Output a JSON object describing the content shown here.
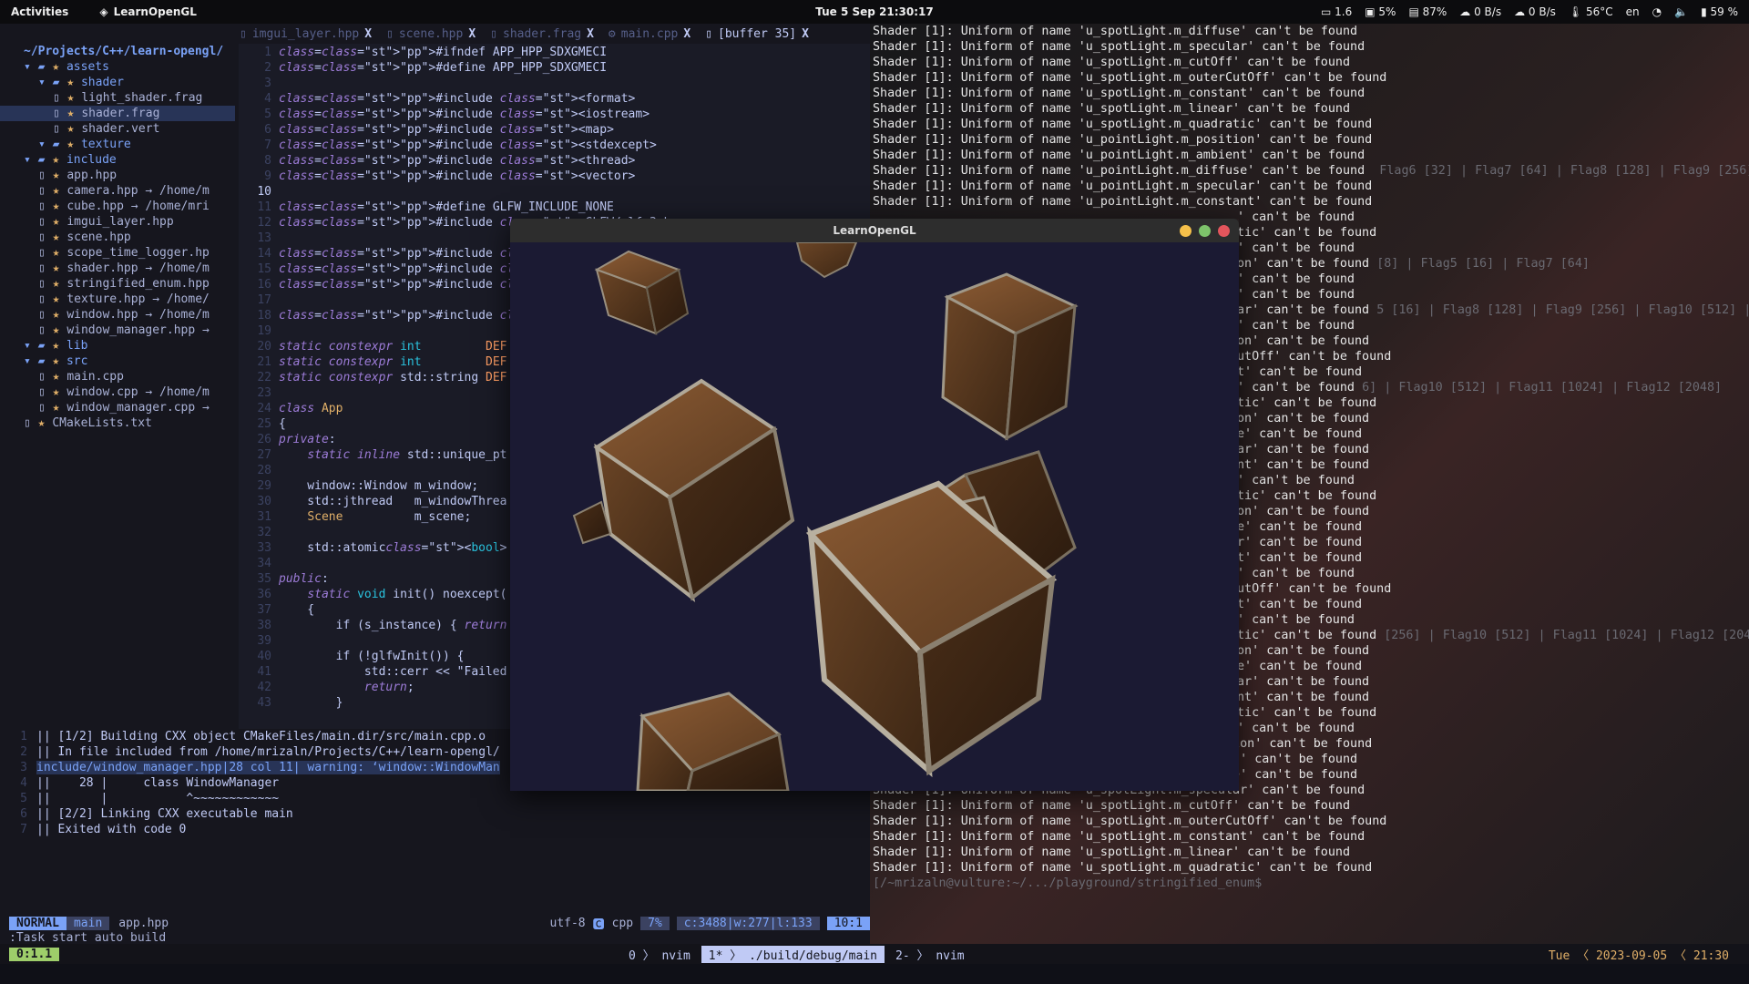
{
  "topbar": {
    "activities": "Activities",
    "app_name": "LearnOpenGL",
    "clock": "Tue 5 Sep  21:30:17",
    "tray": {
      "load": "1.6",
      "cpu": "5%",
      "mem": "87%",
      "down": "0 B/s",
      "up": "0 B/s",
      "temp": "56°C",
      "lang": "en",
      "battery": "59 %"
    }
  },
  "tabs": [
    {
      "label": "imgui_layer.hpp",
      "close": "X"
    },
    {
      "label": "scene.hpp",
      "close": "X"
    },
    {
      "label": "shader.frag",
      "close": "X"
    },
    {
      "label": "main.cpp",
      "close": "X"
    },
    {
      "label": "[buffer 35]",
      "close": "X"
    }
  ],
  "tree": {
    "root": "~/Projects/C++/learn-opengl/",
    "items": [
      {
        "name": "assets",
        "kind": "dir",
        "indent": 1
      },
      {
        "name": "shader",
        "kind": "dir",
        "indent": 2
      },
      {
        "name": "light_shader.frag",
        "kind": "file",
        "indent": 3
      },
      {
        "name": "shader.frag",
        "kind": "file",
        "indent": 3,
        "selected": true
      },
      {
        "name": "shader.vert",
        "kind": "file",
        "indent": 3
      },
      {
        "name": "texture",
        "kind": "dir",
        "indent": 2
      },
      {
        "name": "include",
        "kind": "dir",
        "indent": 1
      },
      {
        "name": "app.hpp",
        "kind": "file",
        "indent": 2
      },
      {
        "name": "camera.hpp → /home/m",
        "kind": "file",
        "indent": 2
      },
      {
        "name": "cube.hpp → /home/mri",
        "kind": "file",
        "indent": 2
      },
      {
        "name": "imgui_layer.hpp",
        "kind": "file",
        "indent": 2
      },
      {
        "name": "scene.hpp",
        "kind": "file",
        "indent": 2
      },
      {
        "name": "scope_time_logger.hp",
        "kind": "file",
        "indent": 2
      },
      {
        "name": "shader.hpp → /home/m",
        "kind": "file",
        "indent": 2
      },
      {
        "name": "stringified_enum.hpp",
        "kind": "file",
        "indent": 2
      },
      {
        "name": "texture.hpp → /home/",
        "kind": "file",
        "indent": 2
      },
      {
        "name": "window.hpp → /home/m",
        "kind": "file",
        "indent": 2
      },
      {
        "name": "window_manager.hpp →",
        "kind": "file",
        "indent": 2
      },
      {
        "name": "lib",
        "kind": "dir",
        "indent": 1
      },
      {
        "name": "src",
        "kind": "dir",
        "indent": 1
      },
      {
        "name": "main.cpp",
        "kind": "file",
        "indent": 2
      },
      {
        "name": "window.cpp → /home/m",
        "kind": "file",
        "indent": 2
      },
      {
        "name": "window_manager.cpp →",
        "kind": "file",
        "indent": 2
      },
      {
        "name": "CMakeLists.txt",
        "kind": "file",
        "indent": 1
      }
    ]
  },
  "code_lines": [
    "#ifndef APP_HPP_SDXGMECI",
    "#define APP_HPP_SDXGMECI",
    "",
    "#include <format>",
    "#include <iostream>",
    "#include <map>",
    "#include <stdexcept>",
    "#include <thread>",
    "#include <vector>",
    "",
    "#define GLFW_INCLUDE_NONE",
    "#include <GLFW/glfw3.h>",
    "",
    "#include \"window.hpp\"",
    "#include \"window_manager.hpp\"",
    "#include \"scope_time_logger.hpp\"",
    "",
    "#include \"scene.hpp\"",
    "",
    "static constexpr int         DEF",
    "static constexpr int         DEF",
    "static constexpr std::string DEF",
    "",
    "class App",
    "{",
    "private:",
    "    static inline std::unique_pt",
    "",
    "    window::Window m_window;",
    "    std::jthread   m_windowThrea",
    "    Scene          m_scene;",
    "",
    "    std::atomic<bool> m_running{",
    "",
    "public:",
    "    static void init() noexcept(",
    "    {",
    "        if (s_instance) { return",
    "",
    "        if (!glfwInit()) {",
    "            std::cerr << \"Failed",
    "            return;",
    "        }"
  ],
  "quickfix": [
    "|| [1/2] Building CXX object CMakeFiles/main.dir/src/main.cpp.o",
    "|| In file included from /home/mrizaln/Projects/C++/learn-opengl/",
    "include/window_manager.hpp|28 col 11| warning: ‘window::WindowMan",
    "||    28 |     class WindowManager",
    "||       |           ^~~~~~~~~~~~~",
    "|| [2/2] Linking CXX executable main",
    "|| Exited with code 0"
  ],
  "statusline": {
    "mode": "NORMAL",
    "branch": " main",
    "file": "app.hpp",
    "encoding": "utf-8",
    "filetype": "cpp",
    "percent": "7%",
    "counts": "c:3488|w:277|l:133",
    "position": "10:1"
  },
  "cmdline": ":Task start auto build",
  "terminal_lines": [
    "Shader [1]: Uniform of name 'u_spotLight.m_diffuse' can't be found",
    "Shader [1]: Uniform of name 'u_spotLight.m_specular' can't be found",
    "Shader [1]: Uniform of name 'u_spotLight.m_cutOff' can't be found",
    "Shader [1]: Uniform of name 'u_spotLight.m_outerCutOff' can't be found",
    "Shader [1]: Uniform of name 'u_spotLight.m_constant' can't be found",
    "Shader [1]: Uniform of name 'u_spotLight.m_linear' can't be found",
    "Shader [1]: Uniform of name 'u_spotLight.m_quadratic' can't be found",
    "Shader [1]: Uniform of name 'u_pointLight.m_position' can't be found",
    "Shader [1]: Uniform of name 'u_pointLight.m_ambient' can't be found",
    "Shader [1]: Uniform of name 'u_pointLight.m_diffuse' can't be found",
    "Shader [1]: Uniform of name 'u_pointLight.m_specular' can't be found",
    "Shader [1]: Uniform of name 'u_pointLight.m_constant' can't be found"
  ],
  "terminal_ghost": [
    {
      "row": 9,
      "text": "Flag6 [32] | Flag7 [64] | Flag8 [128] | Flag9 [256]"
    },
    {
      "row": 15,
      "text": "[8] | Flag5 [16] | Flag7 [64]"
    },
    {
      "row": 18,
      "text": "5 [16] | Flag8 [128] | Flag9 [256] | Flag10 [512] |"
    },
    {
      "row": 23,
      "text": "6] | Flag10 [512] | Flag11 [1024] | Flag12 [2048]"
    },
    {
      "row": 39,
      "text": "[256] | Flag10 [512] | Flag11 [1024] | Flag12 [2048]"
    }
  ],
  "terminal_right_col": [
    "' can't be found",
    "tic' can't be found",
    "' can't be found",
    "on' can't be found",
    "' can't be found",
    "' can't be found",
    "ar' can't be found",
    "' can't be found",
    "on' can't be found",
    "utOff' can't be found",
    "t' can't be found",
    "' can't be found",
    "tic' can't be found",
    "on' can't be found",
    "e' can't be found",
    "ar' can't be found",
    "nt' can't be found",
    "' can't be found",
    "tic' can't be found",
    "on' can't be found",
    "e' can't be found",
    "r' can't be found",
    "t' can't be found",
    "' can't be found",
    "utOff' can't be found",
    "t' can't be found",
    "' can't be found",
    "tic' can't be found",
    "on' can't be found",
    "e' can't be found",
    "ar' can't be found",
    "nt' can't be found",
    "tic' can't be found",
    "' can't be found"
  ],
  "terminal_bottom": [
    "Shader [1]: Uniform of name 'u_spotLight.m_direction' can't be found",
    "Shader [1]: Uniform of name 'u_spotLight.m_ambient' can't be found",
    "Shader [1]: Uniform of name 'u_spotLight.m_diffuse' can't be found",
    "Shader [1]: Uniform of name 'u_spotLight.m_specular' can't be found",
    "Shader [1]: Uniform of name 'u_spotLight.m_cutOff' can't be found",
    "Shader [1]: Uniform of name 'u_spotLight.m_outerCutOff' can't be found",
    "Shader [1]: Uniform of name 'u_spotLight.m_constant' can't be found",
    "Shader [1]: Uniform of name 'u_spotLight.m_linear' can't be found",
    "Shader [1]: Uniform of name 'u_spotLight.m_quadratic' can't be found"
  ],
  "terminal_prompt": "[/~mrizaln@vulture:~/.../playground/stringified_enum$",
  "glwindow": {
    "title": "LearnOpenGL"
  },
  "tmux": {
    "session": "0:1.1",
    "windows": [
      {
        "index": "0",
        "name": "nvim",
        "active": false
      },
      {
        "index": "1*",
        "name": "./build/debug/main",
        "active": true
      },
      {
        "index": "2-",
        "name": "nvim",
        "active": false
      }
    ],
    "right": "Tue 〈 2023-09-05 〈 21:30"
  }
}
